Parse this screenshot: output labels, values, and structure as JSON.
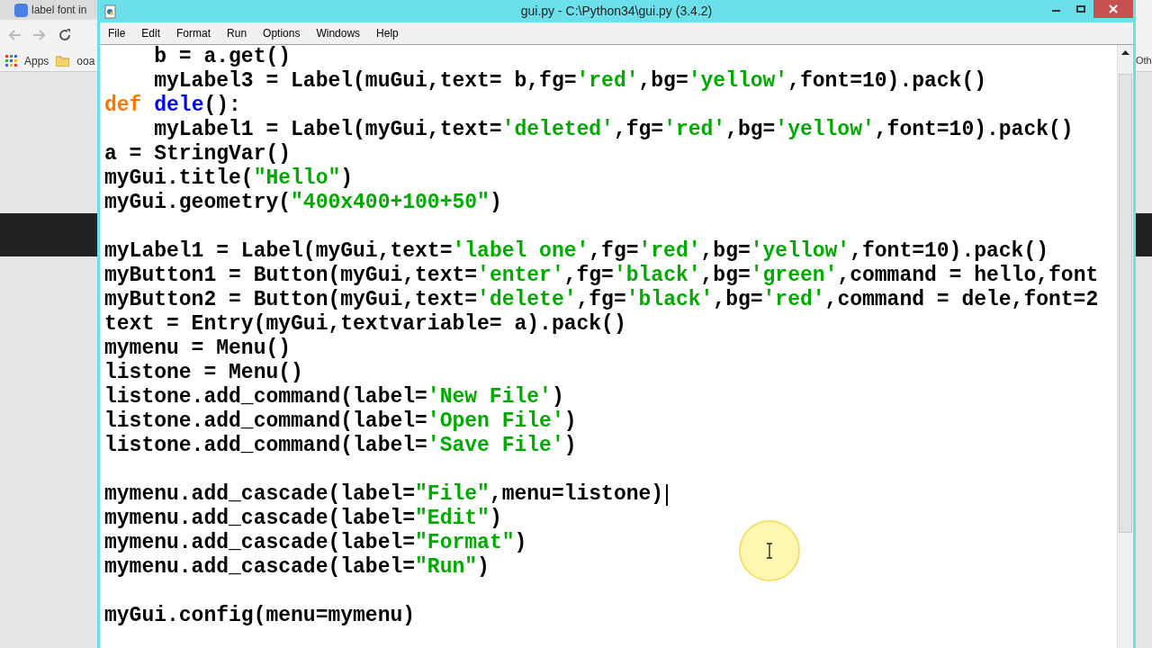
{
  "browser": {
    "tab_title": "label font in",
    "bookmarks": [
      "Apps",
      "ooa"
    ],
    "bookmark_right": "Oth"
  },
  "window": {
    "title": "gui.py - C:\\Python34\\gui.py (3.4.2)"
  },
  "menu": [
    "File",
    "Edit",
    "Format",
    "Run",
    "Options",
    "Windows",
    "Help"
  ],
  "code_lines": [
    {
      "kind": "code",
      "caret": false,
      "tokens": [
        {
          "kind": "plain",
          "text": "    b = a.get()"
        }
      ]
    },
    {
      "kind": "code",
      "caret": false,
      "tokens": [
        {
          "kind": "plain",
          "text": "    myLabel3 = Label(muGui,text= b,fg="
        },
        {
          "kind": "string",
          "text": "'red'"
        },
        {
          "kind": "plain",
          "text": ",bg="
        },
        {
          "kind": "string",
          "text": "'yellow'"
        },
        {
          "kind": "plain",
          "text": ",font=10).pack()"
        }
      ]
    },
    {
      "kind": "code",
      "caret": false,
      "tokens": [
        {
          "kind": "keyword",
          "text": "def"
        },
        {
          "kind": "defname",
          "text": " dele"
        },
        {
          "kind": "plain",
          "text": "():"
        }
      ]
    },
    {
      "kind": "code",
      "caret": false,
      "tokens": [
        {
          "kind": "plain",
          "text": "    myLabel1 = Label(myGui,text="
        },
        {
          "kind": "string",
          "text": "'deleted'"
        },
        {
          "kind": "plain",
          "text": ",fg="
        },
        {
          "kind": "string",
          "text": "'red'"
        },
        {
          "kind": "plain",
          "text": ",bg="
        },
        {
          "kind": "string",
          "text": "'yellow'"
        },
        {
          "kind": "plain",
          "text": ",font=10).pack()"
        }
      ]
    },
    {
      "kind": "code",
      "caret": false,
      "tokens": [
        {
          "kind": "plain",
          "text": "a = StringVar()"
        }
      ]
    },
    {
      "kind": "code",
      "caret": false,
      "tokens": [
        {
          "kind": "plain",
          "text": "myGui.title("
        },
        {
          "kind": "string",
          "text": "\"Hello\""
        },
        {
          "kind": "plain",
          "text": ")"
        }
      ]
    },
    {
      "kind": "code",
      "caret": false,
      "tokens": [
        {
          "kind": "plain",
          "text": "myGui.geometry("
        },
        {
          "kind": "string",
          "text": "\"400x400+100+50\""
        },
        {
          "kind": "plain",
          "text": ")"
        }
      ]
    },
    {
      "kind": "blank",
      "caret": false
    },
    {
      "kind": "code",
      "caret": false,
      "tokens": [
        {
          "kind": "plain",
          "text": "myLabel1 = Label(myGui,text="
        },
        {
          "kind": "string",
          "text": "'label one'"
        },
        {
          "kind": "plain",
          "text": ",fg="
        },
        {
          "kind": "string",
          "text": "'red'"
        },
        {
          "kind": "plain",
          "text": ",bg="
        },
        {
          "kind": "string",
          "text": "'yellow'"
        },
        {
          "kind": "plain",
          "text": ",font=10).pack()"
        }
      ]
    },
    {
      "kind": "code",
      "caret": false,
      "tokens": [
        {
          "kind": "plain",
          "text": "myButton1 = Button(myGui,text="
        },
        {
          "kind": "string",
          "text": "'enter'"
        },
        {
          "kind": "plain",
          "text": ",fg="
        },
        {
          "kind": "string",
          "text": "'black'"
        },
        {
          "kind": "plain",
          "text": ",bg="
        },
        {
          "kind": "string",
          "text": "'green'"
        },
        {
          "kind": "plain",
          "text": ",command = hello,font"
        }
      ]
    },
    {
      "kind": "code",
      "caret": false,
      "tokens": [
        {
          "kind": "plain",
          "text": "myButton2 = Button(myGui,text="
        },
        {
          "kind": "string",
          "text": "'delete'"
        },
        {
          "kind": "plain",
          "text": ",fg="
        },
        {
          "kind": "string",
          "text": "'black'"
        },
        {
          "kind": "plain",
          "text": ",bg="
        },
        {
          "kind": "string",
          "text": "'red'"
        },
        {
          "kind": "plain",
          "text": ",command = dele,font=2"
        }
      ]
    },
    {
      "kind": "code",
      "caret": false,
      "tokens": [
        {
          "kind": "plain",
          "text": "text = Entry(myGui,textvariable= a).pack()"
        }
      ]
    },
    {
      "kind": "code",
      "caret": false,
      "tokens": [
        {
          "kind": "plain",
          "text": "mymenu = Menu()"
        }
      ]
    },
    {
      "kind": "code",
      "caret": false,
      "tokens": [
        {
          "kind": "plain",
          "text": "listone = Menu()"
        }
      ]
    },
    {
      "kind": "code",
      "caret": false,
      "tokens": [
        {
          "kind": "plain",
          "text": "listone.add_command(label="
        },
        {
          "kind": "string",
          "text": "'New File'"
        },
        {
          "kind": "plain",
          "text": ")"
        }
      ]
    },
    {
      "kind": "code",
      "caret": false,
      "tokens": [
        {
          "kind": "plain",
          "text": "listone.add_command(label="
        },
        {
          "kind": "string",
          "text": "'Open File'"
        },
        {
          "kind": "plain",
          "text": ")"
        }
      ]
    },
    {
      "kind": "code",
      "caret": false,
      "tokens": [
        {
          "kind": "plain",
          "text": "listone.add_command(label="
        },
        {
          "kind": "string",
          "text": "'Save File'"
        },
        {
          "kind": "plain",
          "text": ")"
        }
      ]
    },
    {
      "kind": "blank",
      "caret": false
    },
    {
      "kind": "code",
      "caret": true,
      "tokens": [
        {
          "kind": "plain",
          "text": "mymenu.add_cascade(label="
        },
        {
          "kind": "string",
          "text": "\"File\""
        },
        {
          "kind": "plain",
          "text": ",menu=listone)"
        }
      ]
    },
    {
      "kind": "code",
      "caret": false,
      "tokens": [
        {
          "kind": "plain",
          "text": "mymenu.add_cascade(label="
        },
        {
          "kind": "string",
          "text": "\"Edit\""
        },
        {
          "kind": "plain",
          "text": ")"
        }
      ]
    },
    {
      "kind": "code",
      "caret": false,
      "tokens": [
        {
          "kind": "plain",
          "text": "mymenu.add_cascade(label="
        },
        {
          "kind": "string",
          "text": "\"Format\""
        },
        {
          "kind": "plain",
          "text": ")"
        }
      ]
    },
    {
      "kind": "code",
      "caret": false,
      "tokens": [
        {
          "kind": "plain",
          "text": "mymenu.add_cascade(label="
        },
        {
          "kind": "string",
          "text": "\"Run\""
        },
        {
          "kind": "plain",
          "text": ")"
        }
      ]
    },
    {
      "kind": "blank",
      "caret": false
    },
    {
      "kind": "code",
      "caret": false,
      "tokens": [
        {
          "kind": "plain",
          "text": "myGui.config(menu=mymenu)"
        }
      ]
    }
  ]
}
